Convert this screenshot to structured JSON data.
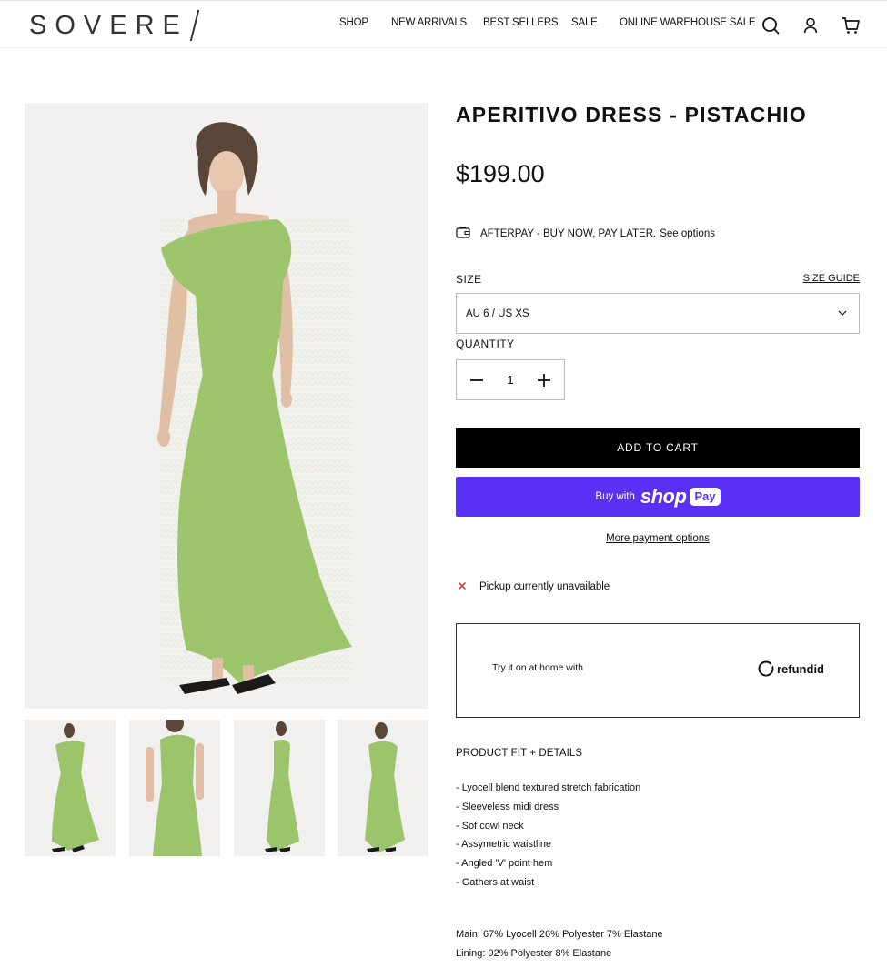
{
  "brand": {
    "logo_text": "SOVERE"
  },
  "nav": {
    "items": [
      "SHOP",
      "NEW ARRIVALS",
      "BEST SELLERS",
      "SALE",
      "ONLINE WAREHOUSE SALE"
    ]
  },
  "header_icons": [
    "search-icon",
    "account-icon",
    "cart-icon"
  ],
  "product": {
    "title": "APERITIVO DRESS - PISTACHIO",
    "price": "$199.00",
    "afterpay_text": "AFTERPAY - BUY NOW, PAY LATER.",
    "afterpay_link": "See options",
    "size_label": "SIZE",
    "size_guide": "SIZE GUIDE",
    "size_selected": "AU 6 / US XS",
    "quantity_label": "QUANTITY",
    "quantity_value": "1",
    "add_to_cart": "ADD TO CART",
    "buy_with": "Buy with",
    "shop_pay_logo": "shop",
    "shop_pay_badge": "Pay",
    "more_payment": "More payment options",
    "pickup": "Pickup currently unavailable",
    "refundid_text": "Try it on at home with",
    "refundid_logo": "refundid",
    "details_heading": "PRODUCT FIT + DETAILS",
    "details": [
      "- Lyocell blend textured stretch fabrication",
      "- Sleeveless midi dress",
      "- Sof cowl neck",
      "- Assymetric waistline",
      "- Angled 'V' point hem",
      "- Gathers at waist"
    ],
    "fabric_main": "Main: 67% Lyocell 26% Polyester 7% Elastane",
    "fabric_lining": "Lining: 92% Polyester 8% Elastane"
  },
  "colors": {
    "dress_green": "#9cc46a",
    "shop_pay_purple": "#5a31f4",
    "cta_black": "#000000",
    "pickup_red": "#d62828"
  }
}
